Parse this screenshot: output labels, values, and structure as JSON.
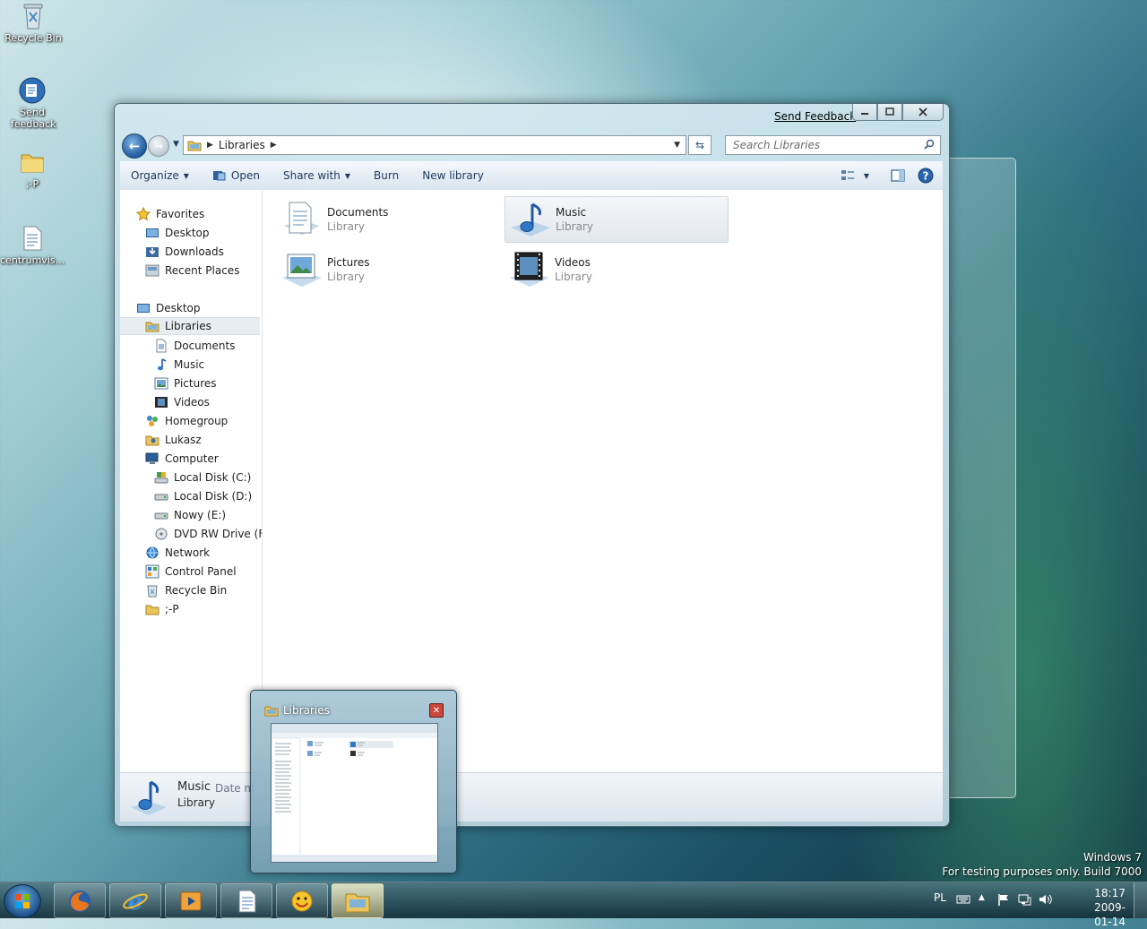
{
  "desktop": {
    "icons": [
      {
        "label": "Recycle Bin",
        "icon": "recycle-bin-icon"
      },
      {
        "label": "Send feedback",
        "icon": "send-feedback-icon"
      },
      {
        "label": ";-P",
        "icon": "folder-icon"
      },
      {
        "label": "centrumvis...",
        "icon": "document-icon"
      }
    ],
    "watermark": {
      "line1": "Windows 7",
      "line2": "For testing purposes only. Build 7000"
    }
  },
  "window": {
    "send_feedback": "Send Feedback",
    "address": {
      "root": "Libraries"
    },
    "search": {
      "placeholder": "Search Libraries"
    },
    "toolbar": {
      "organize": "Organize",
      "open": "Open",
      "share_with": "Share with",
      "burn": "Burn",
      "new_library": "New library"
    },
    "nav": {
      "favorites": "Favorites",
      "desktop_fav": "Desktop",
      "downloads": "Downloads",
      "recent_places": "Recent Places",
      "desktop": "Desktop",
      "libraries": "Libraries",
      "documents": "Documents",
      "music": "Music",
      "pictures": "Pictures",
      "videos": "Videos",
      "homegroup": "Homegroup",
      "lukasz": "Lukasz",
      "computer": "Computer",
      "local_c": "Local Disk (C:)",
      "local_d": "Local Disk (D:)",
      "nowy_e": "Nowy (E:)",
      "dvd_f": "DVD RW Drive (F:)",
      "network": "Network",
      "control_panel": "Control Panel",
      "recycle_bin": "Recycle Bin",
      "tongue": ";-P"
    },
    "libraries": [
      {
        "name": "Documents",
        "type": "Library"
      },
      {
        "name": "Music",
        "type": "Library"
      },
      {
        "name": "Pictures",
        "type": "Library"
      },
      {
        "name": "Videos",
        "type": "Library"
      }
    ],
    "details": {
      "name": "Music",
      "date_label": "Date m",
      "type": "Library"
    }
  },
  "thumbnail": {
    "title": "Libraries"
  },
  "taskbar": {
    "language": "PL",
    "time": "18:17",
    "date": "2009-01-14"
  },
  "colors": {
    "accent": "#1f5a9e",
    "toolbar_text": "#1e395b"
  }
}
